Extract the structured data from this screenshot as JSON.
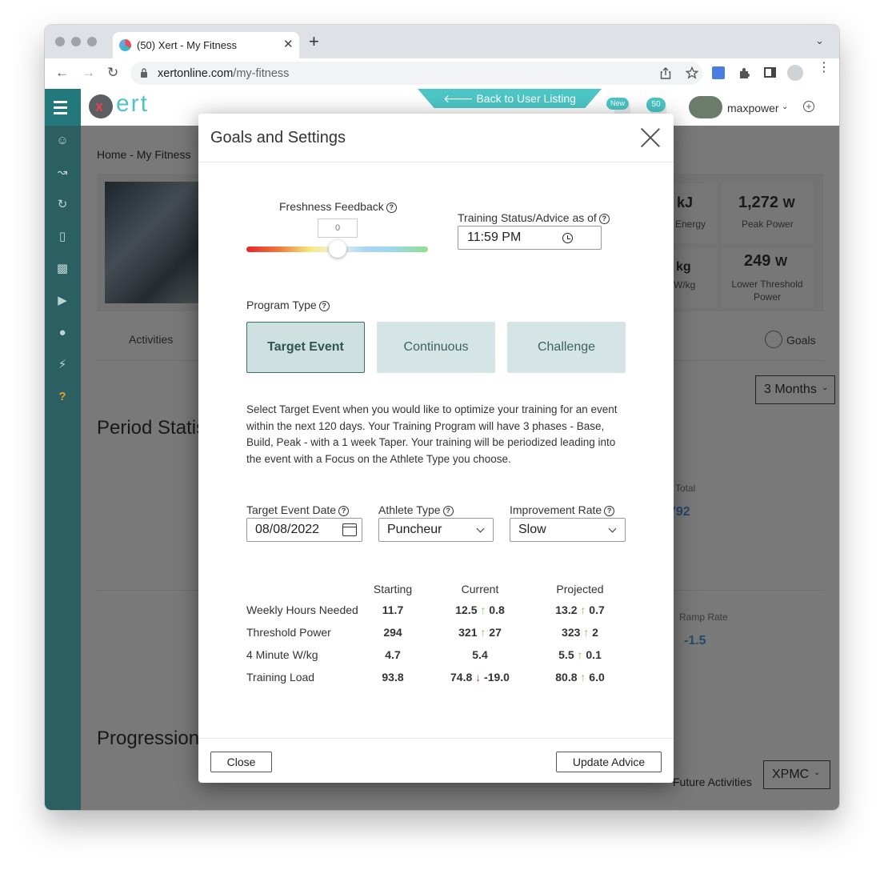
{
  "browser": {
    "tab_title": "(50) Xert - My Fitness",
    "tab_close": "✕",
    "new_tab": "+",
    "tab_menu": "⌄",
    "url_domain": "xertonline.com",
    "url_path": "/my-fitness"
  },
  "site": {
    "logo_text": "ert",
    "back_link": "🡐 Back to User Listing",
    "badge_new": "New",
    "badge_count": "50",
    "username": "maxpower",
    "breadcrumb": "Home - My Fitness"
  },
  "background": {
    "stat1_value": "1,272",
    "stat1_unit": "W",
    "stat1_label": "Peak Power",
    "stat2_value": "249",
    "stat2_unit": "W",
    "stat2_label": "Lower Threshold Power",
    "partial_kj": "kJ",
    "partial_energy": "Energy",
    "partial_kg": "kg",
    "partial_wkg": "W/kg",
    "tab_activities": "Activities",
    "tab_goals": "Goals",
    "range_select": "3 Months",
    "period_stats": "Period Statis",
    "total_label": "Total",
    "total_value": "792",
    "ramp_label": "Ramp Rate",
    "ramp_value": "-1.5",
    "progression": "Progression",
    "future_label": "Future Activities",
    "xpmc_select": "XPMC"
  },
  "modal": {
    "title": "Goals and Settings",
    "freshness_label": "Freshness Feedback",
    "freshness_value": "0",
    "freshness_level": 0.5,
    "training_status_label": "Training Status/Advice as of",
    "training_time": "11:59  PM",
    "program_type_label": "Program Type",
    "program_types": [
      "Target Event",
      "Continuous",
      "Challenge"
    ],
    "selected_program": "Target Event",
    "description": "Select Target Event when you would like to optimize your training for an event within the next 120 days. Your Training Program will have 3 phases - Base, Build, Peak - with a 1 week Taper. Your training will be periodized leading into the event with a Focus on the Athlete Type you choose.",
    "target_date_label": "Target Event Date",
    "target_date": "08/08/2022",
    "athlete_type_label": "Athlete Type",
    "athlete_type": "Puncheur",
    "improvement_label": "Improvement Rate",
    "improvement_rate": "Slow",
    "table_headers": [
      "Starting",
      "Current",
      "Projected"
    ],
    "rows": [
      {
        "label": "Weekly Hours Needed",
        "starting": "11.7",
        "current": "12.5",
        "current_dir": "up",
        "current_delta": "0.8",
        "projected": "13.2",
        "projected_dir": "up",
        "projected_delta": "0.7"
      },
      {
        "label": "Threshold Power",
        "starting": "294",
        "current": "321",
        "current_dir": "up",
        "current_delta": "27",
        "projected": "323",
        "projected_dir": "up",
        "projected_delta": "2"
      },
      {
        "label": "4 Minute W/kg",
        "starting": "4.7",
        "current": "5.4",
        "current_dir": "",
        "current_delta": "",
        "projected": "5.5",
        "projected_dir": "up",
        "projected_delta": "0.1"
      },
      {
        "label": "Training Load",
        "starting": "93.8",
        "current": "74.8",
        "current_dir": "down",
        "current_delta": "-19.0",
        "projected": "80.8",
        "projected_dir": "up",
        "projected_delta": "6.0"
      }
    ],
    "close_button": "Close",
    "update_button": "Update Advice"
  }
}
